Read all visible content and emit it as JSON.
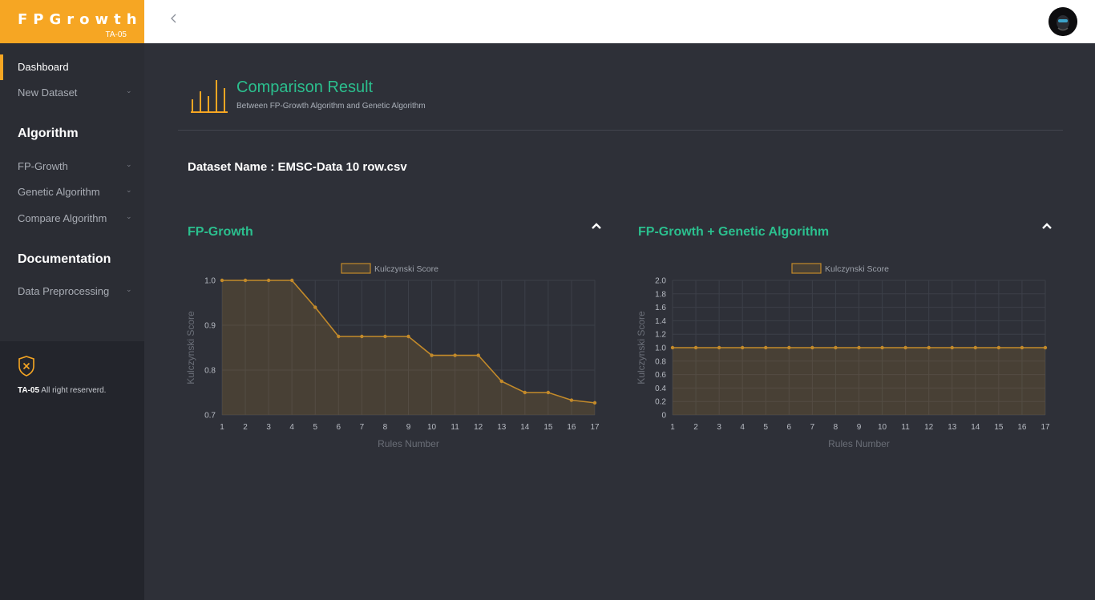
{
  "brand": {
    "name": "FPGrowth",
    "sub": "TA-05"
  },
  "topbar": {
    "collapse_icon": "chevron-left-icon",
    "avatar_icon": "user-avatar"
  },
  "sidebar": {
    "items": [
      {
        "label": "Dashboard",
        "active": true
      },
      {
        "label": "New Dataset",
        "chevron": "⌄"
      }
    ],
    "algorithm_heading": "Algorithm",
    "algorithm_items": [
      {
        "label": "FP-Growth",
        "chevron": "⌄"
      },
      {
        "label": "Genetic Algorithm",
        "chevron": "⌄"
      },
      {
        "label": "Compare Algorithm",
        "chevron": "⌄"
      }
    ],
    "documentation_heading": "Documentation",
    "documentation_items": [
      {
        "label": "Data Preprocessing",
        "chevron": "⌄"
      }
    ],
    "footer": {
      "team": "TA-05",
      "text": "All right reserverd."
    }
  },
  "page": {
    "title": "Comparison Result",
    "subtitle": "Between FP-Growth Algorithm and Genetic Algorithm",
    "dataset_label": "Dataset Name : EMSC-Data 10 row.csv"
  },
  "panels": [
    {
      "title": "FP-Growth"
    },
    {
      "title": "FP-Growth + Genetic Algorithm"
    }
  ],
  "colors": {
    "accent": "#f6a623",
    "title_green": "#2bbf8e",
    "line": "#c38a2a",
    "fill": "rgba(195,138,42,0.18)"
  },
  "chart_data": [
    {
      "type": "line",
      "series": [
        {
          "name": "Kulczynski Score",
          "values": [
            1.0,
            1.0,
            1.0,
            1.0,
            0.94,
            0.875,
            0.875,
            0.875,
            0.875,
            0.833,
            0.833,
            0.833,
            0.775,
            0.75,
            0.75,
            0.733,
            0.727
          ]
        }
      ],
      "x": [
        1,
        2,
        3,
        4,
        5,
        6,
        7,
        8,
        9,
        10,
        11,
        12,
        13,
        14,
        15,
        16,
        17
      ],
      "xlabel": "Rules Number",
      "ylabel": "Kulczynski Score",
      "ylim": [
        0.7,
        1.0
      ],
      "yticks": [
        "1.0",
        "0.9",
        "0.8",
        "0.7"
      ],
      "ytick_values": [
        1.0,
        0.9,
        0.8,
        0.7
      ],
      "legend": "top-center",
      "grid": true
    },
    {
      "type": "line",
      "series": [
        {
          "name": "Kulczynski Score",
          "values": [
            1,
            1,
            1,
            1,
            1,
            1,
            1,
            1,
            1,
            1,
            1,
            1,
            1,
            1,
            1,
            1,
            1
          ]
        }
      ],
      "x": [
        1,
        2,
        3,
        4,
        5,
        6,
        7,
        8,
        9,
        10,
        11,
        12,
        13,
        14,
        15,
        16,
        17
      ],
      "xlabel": "Rules Number",
      "ylabel": "Kulczynski Score",
      "ylim": [
        0,
        2.0
      ],
      "yticks": [
        "2.0",
        "1.8",
        "1.6",
        "1.4",
        "1.2",
        "1.0",
        "0.8",
        "0.6",
        "0.4",
        "0.2",
        "0"
      ],
      "ytick_values": [
        2.0,
        1.8,
        1.6,
        1.4,
        1.2,
        1.0,
        0.8,
        0.6,
        0.4,
        0.2,
        0
      ],
      "legend": "top-center",
      "grid": true
    }
  ]
}
